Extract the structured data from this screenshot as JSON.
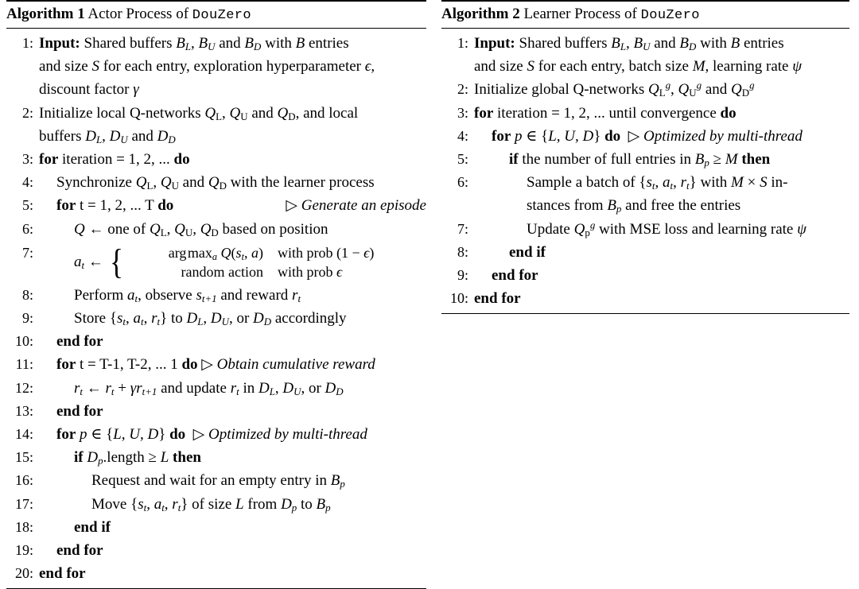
{
  "document": {
    "type": "algorithm-figure",
    "background": "#ffffff",
    "text_color": "#000000"
  },
  "algorithm_1": {
    "id": "Algorithm 1",
    "label_prefix": "Algorithm",
    "number": "1",
    "title_text": "Actor Process of",
    "title_mono": "DouZero",
    "lines": [
      {
        "n": "1:",
        "indent": 0,
        "text": "Input: Shared buffers B_L, B_U and B_D with B entries and size S for each entry, exploration hyperparameter ϵ, discount factor γ"
      },
      {
        "n": "2:",
        "indent": 0,
        "text": "Initialize local Q-networks Q_L, Q_U and Q_D, and local buffers D_L, D_U and D_D"
      },
      {
        "n": "3:",
        "indent": 0,
        "text": "for iteration = 1, 2, ... do"
      },
      {
        "n": "4:",
        "indent": 1,
        "text": "Synchronize Q_L, Q_U and Q_D with the learner process"
      },
      {
        "n": "5:",
        "indent": 1,
        "text": "for t = 1, 2, ... T do",
        "comment": "▷ Generate an episode"
      },
      {
        "n": "6:",
        "indent": 2,
        "text": "Q ← one of Q_L, Q_U, Q_D based on position"
      },
      {
        "n": "7:",
        "indent": 2,
        "text": "a_t ← { arg max_a Q(s_t, a) with prob (1 − ϵ) ; random action with prob ϵ",
        "case_1_expr": "arg max_a Q(s_t, a)",
        "case_1_cond": "with prob (1 − ϵ)",
        "case_2_expr": "random action",
        "case_2_cond": "with prob ϵ"
      },
      {
        "n": "8:",
        "indent": 2,
        "text": "Perform a_t, observe s_{t+1} and reward r_t"
      },
      {
        "n": "9:",
        "indent": 2,
        "text": "Store {s_t, a_t, r_t} to D_L, D_U, or D_D accordingly"
      },
      {
        "n": "10:",
        "indent": 1,
        "text": "end for"
      },
      {
        "n": "11:",
        "indent": 1,
        "text": "for t = T-1, T-2, ... 1 do",
        "comment": "▷ Obtain cumulative reward"
      },
      {
        "n": "12:",
        "indent": 2,
        "text": "r_t ← r_t + γr_{t+1} and update r_t in D_L, D_U, or D_D"
      },
      {
        "n": "13:",
        "indent": 1,
        "text": "end for"
      },
      {
        "n": "14:",
        "indent": 1,
        "text": "for p ∈ {L, U, D} do",
        "comment": "▷ Optimized by multi-thread"
      },
      {
        "n": "15:",
        "indent": 2,
        "text": "if D_p.length ≥ L then"
      },
      {
        "n": "16:",
        "indent": 3,
        "text": "Request and wait for an empty entry in B_p"
      },
      {
        "n": "17:",
        "indent": 3,
        "text": "Move {s_t, a_t, r_t} of size L from D_p to B_p"
      },
      {
        "n": "18:",
        "indent": 2,
        "text": "end if"
      },
      {
        "n": "19:",
        "indent": 1,
        "text": "end for"
      },
      {
        "n": "20:",
        "indent": 0,
        "text": "end for"
      }
    ]
  },
  "algorithm_2": {
    "id": "Algorithm 2",
    "label_prefix": "Algorithm",
    "number": "2",
    "title_text": "Learner Process of",
    "title_mono": "DouZero",
    "lines": [
      {
        "n": "1:",
        "indent": 0,
        "text": "Input: Shared buffers B_L, B_U and B_D with B entries and size S for each entry, batch size M, learning rate ψ"
      },
      {
        "n": "2:",
        "indent": 0,
        "text": "Initialize global Q-networks Q^g_L, Q^g_U and Q^g_D"
      },
      {
        "n": "3:",
        "indent": 0,
        "text": "for iteration = 1, 2, ... until convergence do"
      },
      {
        "n": "4:",
        "indent": 1,
        "text": "for p ∈ {L, U, D} do",
        "comment": "▷ Optimized by multi-thread"
      },
      {
        "n": "5:",
        "indent": 2,
        "text": "if the number of full entries in B_p ≥ M then"
      },
      {
        "n": "6:",
        "indent": 3,
        "text": "Sample a batch of {s_t, a_t, r_t} with M × S instances from B_p and free the entries"
      },
      {
        "n": "7:",
        "indent": 3,
        "text": "Update Q^g_p with MSE loss and learning rate ψ"
      },
      {
        "n": "8:",
        "indent": 2,
        "text": "end if"
      },
      {
        "n": "9:",
        "indent": 1,
        "text": "end for"
      },
      {
        "n": "10:",
        "indent": 0,
        "text": "end for"
      }
    ]
  }
}
